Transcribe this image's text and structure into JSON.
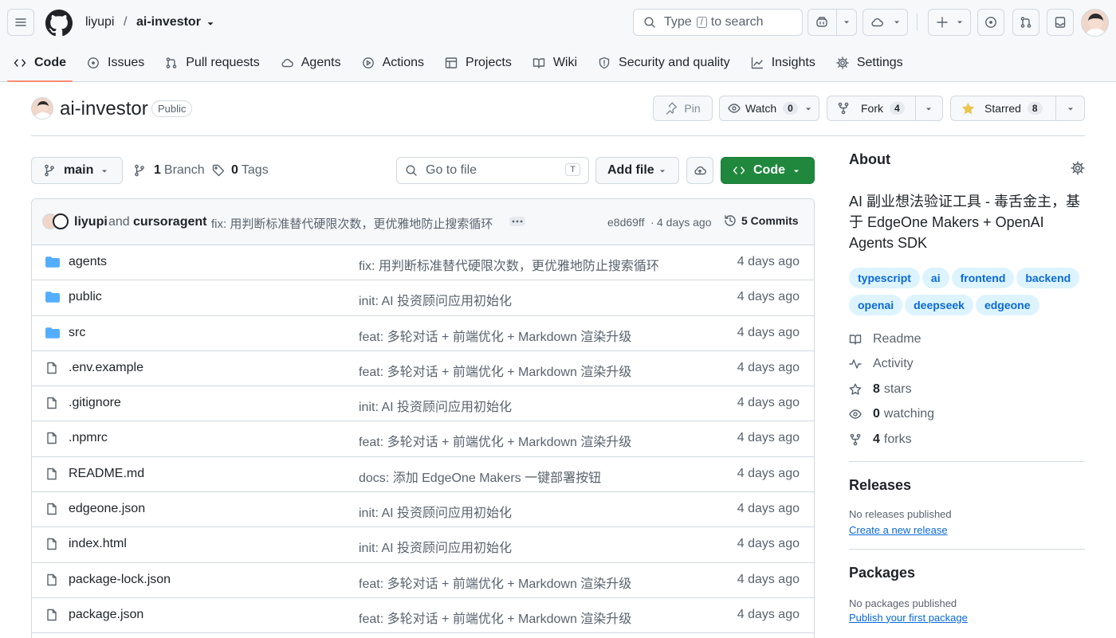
{
  "header": {
    "owner": "liyupi",
    "separator": "/",
    "repo": "ai-investor",
    "search_type": "Type",
    "search_key": "/",
    "search_suffix": "to search"
  },
  "nav": [
    {
      "label": "Code",
      "icon": "code-icon",
      "active": true
    },
    {
      "label": "Issues",
      "icon": "issue-icon"
    },
    {
      "label": "Pull requests",
      "icon": "pull-request-icon"
    },
    {
      "label": "Agents",
      "icon": "agents-icon"
    },
    {
      "label": "Actions",
      "icon": "play-icon"
    },
    {
      "label": "Projects",
      "icon": "table-icon"
    },
    {
      "label": "Wiki",
      "icon": "book-icon"
    },
    {
      "label": "Security and quality",
      "icon": "shield-icon"
    },
    {
      "label": "Insights",
      "icon": "graph-icon"
    },
    {
      "label": "Settings",
      "icon": "gear-icon"
    }
  ],
  "repo": {
    "name": "ai-investor",
    "visibility": "Public",
    "pin": "Pin",
    "watch": "Watch",
    "watch_count": "0",
    "fork": "Fork",
    "fork_count": "4",
    "starred": "Starred",
    "star_count": "8"
  },
  "toolbar": {
    "branch": "main",
    "branches_count": "1",
    "branches_label": "Branch",
    "tags_count": "0",
    "tags_label": "Tags",
    "goto_placeholder": "Go to file",
    "goto_key": "T",
    "add_file": "Add file",
    "code": "Code"
  },
  "commit": {
    "author": "liyupi",
    "and": "and",
    "coauthor": "cursoragent",
    "message": "fix: 用判断标准替代硬限次数，更优雅地防止搜索循环",
    "sha": "e8d69ff",
    "sep": "·",
    "time": "4 days ago",
    "commits": "5 Commits"
  },
  "files": [
    {
      "name": "agents",
      "type": "dir",
      "message": "fix: 用判断标准替代硬限次数，更优雅地防止搜索循环",
      "age": "4 days ago"
    },
    {
      "name": "public",
      "type": "dir",
      "message": "init: AI 投资顾问应用初始化",
      "age": "4 days ago"
    },
    {
      "name": "src",
      "type": "dir",
      "message": "feat: 多轮对话 + 前端优化 + Markdown 渲染升级",
      "age": "4 days ago"
    },
    {
      "name": ".env.example",
      "type": "file",
      "message": "feat: 多轮对话 + 前端优化 + Markdown 渲染升级",
      "age": "4 days ago"
    },
    {
      "name": ".gitignore",
      "type": "file",
      "message": "init: AI 投资顾问应用初始化",
      "age": "4 days ago"
    },
    {
      "name": ".npmrc",
      "type": "file",
      "message": "feat: 多轮对话 + 前端优化 + Markdown 渲染升级",
      "age": "4 days ago"
    },
    {
      "name": "README.md",
      "type": "file",
      "message": "docs: 添加 EdgeOne Makers 一键部署按钮",
      "age": "4 days ago"
    },
    {
      "name": "edgeone.json",
      "type": "file",
      "message": "init: AI 投资顾问应用初始化",
      "age": "4 days ago"
    },
    {
      "name": "index.html",
      "type": "file",
      "message": "init: AI 投资顾问应用初始化",
      "age": "4 days ago"
    },
    {
      "name": "package-lock.json",
      "type": "file",
      "message": "feat: 多轮对话 + 前端优化 + Markdown 渲染升级",
      "age": "4 days ago"
    },
    {
      "name": "package.json",
      "type": "file",
      "message": "feat: 多轮对话 + 前端优化 + Markdown 渲染升级",
      "age": "4 days ago"
    }
  ],
  "about": {
    "title": "About",
    "description": "AI 副业想法验证工具 - 毒舌金主，基于 EdgeOne Makers + OpenAI Agents SDK",
    "topics": [
      "typescript",
      "ai",
      "frontend",
      "backend",
      "openai",
      "deepseek",
      "edgeone"
    ],
    "readme": "Readme",
    "activity": "Activity",
    "stars_count": "8",
    "stars_label": "stars",
    "watching_count": "0",
    "watching_label": "watching",
    "forks_count": "4",
    "forks_label": "forks"
  },
  "releases": {
    "title": "Releases",
    "empty": "No releases published",
    "link": "Create a new release"
  },
  "packages": {
    "title": "Packages",
    "empty": "No packages published",
    "link": "Publish your first package"
  },
  "colors": {
    "accent": "#0969da",
    "code_button": "#1f883d",
    "folder": "#54aeff",
    "active_tab": "#fd8c73",
    "star": "#eac54f"
  }
}
